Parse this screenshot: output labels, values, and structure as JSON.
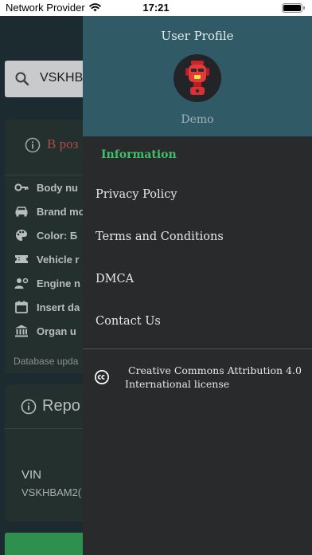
{
  "status_bar": {
    "carrier": "Network Provider",
    "time": "17:21"
  },
  "search": {
    "value": "VSKHB"
  },
  "info_card": {
    "heading": "В роз",
    "rows": [
      {
        "icon": "key-icon",
        "label": "Body nu"
      },
      {
        "icon": "car-icon",
        "label": "Brand mo"
      },
      {
        "icon": "palette-icon",
        "label": "Color: Б"
      },
      {
        "icon": "ticket-icon",
        "label": "Vehicle r"
      },
      {
        "icon": "engine-user-icon",
        "label": "Engine n"
      },
      {
        "icon": "calendar-icon",
        "label": "Insert da"
      },
      {
        "icon": "bank-icon",
        "label": "Organ u"
      }
    ],
    "footer": "Database upda"
  },
  "report_card": {
    "title": "Repo",
    "vin_label": "VIN",
    "vin_value": "VSKHBAM2("
  },
  "drawer": {
    "profile_title": "User Profile",
    "profile_name": "Demo",
    "section_title": "Information",
    "menu": [
      "Privacy Policy",
      "Terms and Conditions",
      "DMCA",
      "Contact Us"
    ],
    "license_line1": "Creative Commons Attribution 4.0",
    "license_line2": "International license"
  },
  "colors": {
    "drawer_header": "#2f5a66",
    "drawer_bg": "#292a2c",
    "section_accent": "#3ec06a",
    "card_bg": "#24302e",
    "warning_text": "#b24a4a",
    "action_button": "#2f8f4f"
  }
}
